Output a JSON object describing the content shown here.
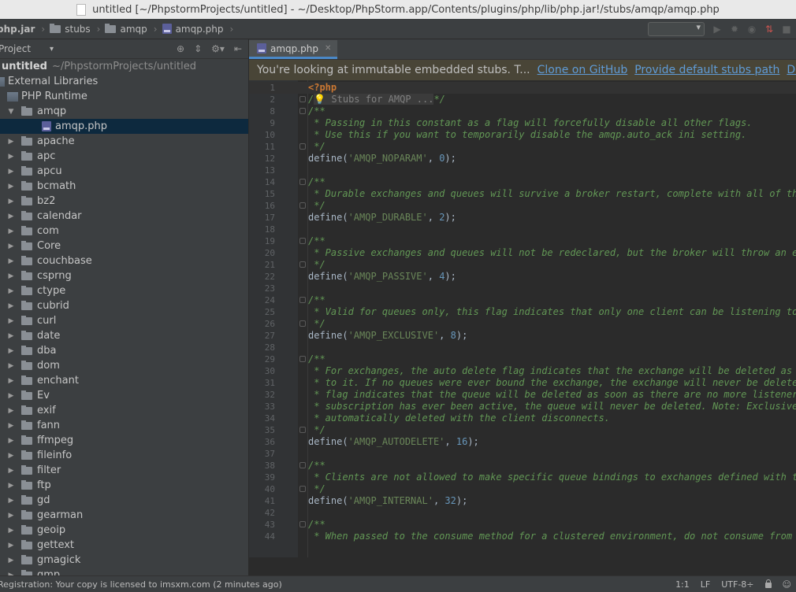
{
  "window": {
    "title": "untitled [~/PhpstormProjects/untitled] - ~/Desktop/PhpStorm.app/Contents/plugins/php/lib/php.jar!/stubs/amqp/amqp.php"
  },
  "navbar": {
    "crumbs": [
      "php.jar",
      "stubs",
      "amqp",
      "amqp.php"
    ]
  },
  "project": {
    "header": "Project",
    "root_name": "untitled",
    "root_path": "~/PhpstormProjects/untitled",
    "external_libraries": "External Libraries",
    "php_runtime": "PHP Runtime",
    "open_folder": "amqp",
    "open_file": "amqp.php",
    "folders": [
      "apache",
      "apc",
      "apcu",
      "bcmath",
      "bz2",
      "calendar",
      "com",
      "Core",
      "couchbase",
      "csprng",
      "ctype",
      "cubrid",
      "curl",
      "date",
      "dba",
      "dom",
      "enchant",
      "Ev",
      "exif",
      "fann",
      "ffmpeg",
      "fileinfo",
      "filter",
      "ftp",
      "gd",
      "gearman",
      "geoip",
      "gettext",
      "gmagick",
      "gmp"
    ]
  },
  "editor": {
    "tab_label": "amqp.php",
    "banner": {
      "text": "You're looking at immutable embedded stubs. T...",
      "links": [
        "Clone on GitHub",
        "Provide default stubs path",
        "Don't show ag"
      ]
    },
    "lines": [
      {
        "n": "1",
        "fold": false,
        "parts": [
          {
            "c": "tag",
            "t": "<?php"
          }
        ]
      },
      {
        "n": "2",
        "fold": true,
        "parts": [
          {
            "c": "cm",
            "t": "/"
          },
          {
            "c": "fold-text",
            "t": "💡 Stubs for AMQP ..."
          },
          {
            "c": "cm",
            "t": "*/"
          }
        ]
      },
      {
        "n": "8",
        "fold": true,
        "parts": [
          {
            "c": "cm",
            "t": "/**"
          }
        ]
      },
      {
        "n": "9",
        "fold": false,
        "parts": [
          {
            "c": "cm",
            "t": " * Passing in this constant as a flag will forcefully disable all other flags."
          }
        ]
      },
      {
        "n": "10",
        "fold": false,
        "parts": [
          {
            "c": "cm",
            "t": " * Use this if you want to temporarily disable the amqp.auto_ack ini setting."
          }
        ]
      },
      {
        "n": "11",
        "fold": true,
        "parts": [
          {
            "c": "cm",
            "t": " */"
          }
        ]
      },
      {
        "n": "12",
        "fold": false,
        "parts": [
          {
            "c": "fn",
            "t": "define("
          },
          {
            "c": "str",
            "t": "'AMQP_NOPARAM'"
          },
          {
            "c": "fn",
            "t": ", "
          },
          {
            "c": "num-lit",
            "t": "0"
          },
          {
            "c": "fn",
            "t": ");"
          }
        ]
      },
      {
        "n": "13",
        "fold": false,
        "parts": []
      },
      {
        "n": "14",
        "fold": true,
        "parts": [
          {
            "c": "cm",
            "t": "/**"
          }
        ]
      },
      {
        "n": "15",
        "fold": false,
        "parts": [
          {
            "c": "cm",
            "t": " * Durable exchanges and queues will survive a broker restart, complete with all of thei"
          }
        ]
      },
      {
        "n": "16",
        "fold": true,
        "parts": [
          {
            "c": "cm",
            "t": " */"
          }
        ]
      },
      {
        "n": "17",
        "fold": false,
        "parts": [
          {
            "c": "fn",
            "t": "define("
          },
          {
            "c": "str",
            "t": "'AMQP_DURABLE'"
          },
          {
            "c": "fn",
            "t": ", "
          },
          {
            "c": "num-lit",
            "t": "2"
          },
          {
            "c": "fn",
            "t": ");"
          }
        ]
      },
      {
        "n": "18",
        "fold": false,
        "parts": []
      },
      {
        "n": "19",
        "fold": true,
        "parts": [
          {
            "c": "cm",
            "t": "/**"
          }
        ]
      },
      {
        "n": "20",
        "fold": false,
        "parts": [
          {
            "c": "cm",
            "t": " * Passive exchanges and queues will not be redeclared, but the broker will throw an err"
          }
        ]
      },
      {
        "n": "21",
        "fold": true,
        "parts": [
          {
            "c": "cm",
            "t": " */"
          }
        ]
      },
      {
        "n": "22",
        "fold": false,
        "parts": [
          {
            "c": "fn",
            "t": "define("
          },
          {
            "c": "str",
            "t": "'AMQP_PASSIVE'"
          },
          {
            "c": "fn",
            "t": ", "
          },
          {
            "c": "num-lit",
            "t": "4"
          },
          {
            "c": "fn",
            "t": ");"
          }
        ]
      },
      {
        "n": "23",
        "fold": false,
        "parts": []
      },
      {
        "n": "24",
        "fold": true,
        "parts": [
          {
            "c": "cm",
            "t": "/**"
          }
        ]
      },
      {
        "n": "25",
        "fold": false,
        "parts": [
          {
            "c": "cm",
            "t": " * Valid for queues only, this flag indicates that only one client can be listening to a"
          }
        ]
      },
      {
        "n": "26",
        "fold": true,
        "parts": [
          {
            "c": "cm",
            "t": " */"
          }
        ]
      },
      {
        "n": "27",
        "fold": false,
        "parts": [
          {
            "c": "fn",
            "t": "define("
          },
          {
            "c": "str",
            "t": "'AMQP_EXCLUSIVE'"
          },
          {
            "c": "fn",
            "t": ", "
          },
          {
            "c": "num-lit",
            "t": "8"
          },
          {
            "c": "fn",
            "t": ");"
          }
        ]
      },
      {
        "n": "28",
        "fold": false,
        "parts": []
      },
      {
        "n": "29",
        "fold": true,
        "parts": [
          {
            "c": "cm",
            "t": "/**"
          }
        ]
      },
      {
        "n": "30",
        "fold": false,
        "parts": [
          {
            "c": "cm",
            "t": " * For exchanges, the auto delete flag indicates that the exchange will be deleted as so"
          }
        ]
      },
      {
        "n": "31",
        "fold": false,
        "parts": [
          {
            "c": "cm",
            "t": " * to it. If no queues were ever bound the exchange, the exchange will never be deleted."
          }
        ]
      },
      {
        "n": "32",
        "fold": false,
        "parts": [
          {
            "c": "cm",
            "t": " * flag indicates that the queue will be deleted as soon as there are no more listeners"
          }
        ]
      },
      {
        "n": "33",
        "fold": false,
        "parts": [
          {
            "c": "cm",
            "t": " * subscription has ever been active, the queue will never be deleted. Note: Exclusive q"
          }
        ]
      },
      {
        "n": "34",
        "fold": false,
        "parts": [
          {
            "c": "cm",
            "t": " * automatically deleted with the client disconnects."
          }
        ]
      },
      {
        "n": "35",
        "fold": true,
        "parts": [
          {
            "c": "cm",
            "t": " */"
          }
        ]
      },
      {
        "n": "36",
        "fold": false,
        "parts": [
          {
            "c": "fn",
            "t": "define("
          },
          {
            "c": "str",
            "t": "'AMQP_AUTODELETE'"
          },
          {
            "c": "fn",
            "t": ", "
          },
          {
            "c": "num-lit",
            "t": "16"
          },
          {
            "c": "fn",
            "t": ");"
          }
        ]
      },
      {
        "n": "37",
        "fold": false,
        "parts": []
      },
      {
        "n": "38",
        "fold": true,
        "parts": [
          {
            "c": "cm",
            "t": "/**"
          }
        ]
      },
      {
        "n": "39",
        "fold": false,
        "parts": [
          {
            "c": "cm",
            "t": " * Clients are not allowed to make specific queue bindings to exchanges defined with thi"
          }
        ]
      },
      {
        "n": "40",
        "fold": true,
        "parts": [
          {
            "c": "cm",
            "t": " */"
          }
        ]
      },
      {
        "n": "41",
        "fold": false,
        "parts": [
          {
            "c": "fn",
            "t": "define("
          },
          {
            "c": "str",
            "t": "'AMQP_INTERNAL'"
          },
          {
            "c": "fn",
            "t": ", "
          },
          {
            "c": "num-lit",
            "t": "32"
          },
          {
            "c": "fn",
            "t": ");"
          }
        ]
      },
      {
        "n": "42",
        "fold": false,
        "parts": []
      },
      {
        "n": "43",
        "fold": true,
        "parts": [
          {
            "c": "cm",
            "t": "/**"
          }
        ]
      },
      {
        "n": "44",
        "fold": false,
        "parts": [
          {
            "c": "cm",
            "t": " * When passed to the consume method for a clustered environment, do not consume from th"
          }
        ]
      }
    ]
  },
  "status": {
    "message": "Registration: Your copy is licensed to imsxm.com (2 minutes ago)",
    "position": "1:1",
    "line_sep": "LF",
    "encoding": "UTF-8÷"
  },
  "colors": {
    "accent": "#4a88c7",
    "selection": "#0d293e",
    "banner_bg": "#494537"
  }
}
